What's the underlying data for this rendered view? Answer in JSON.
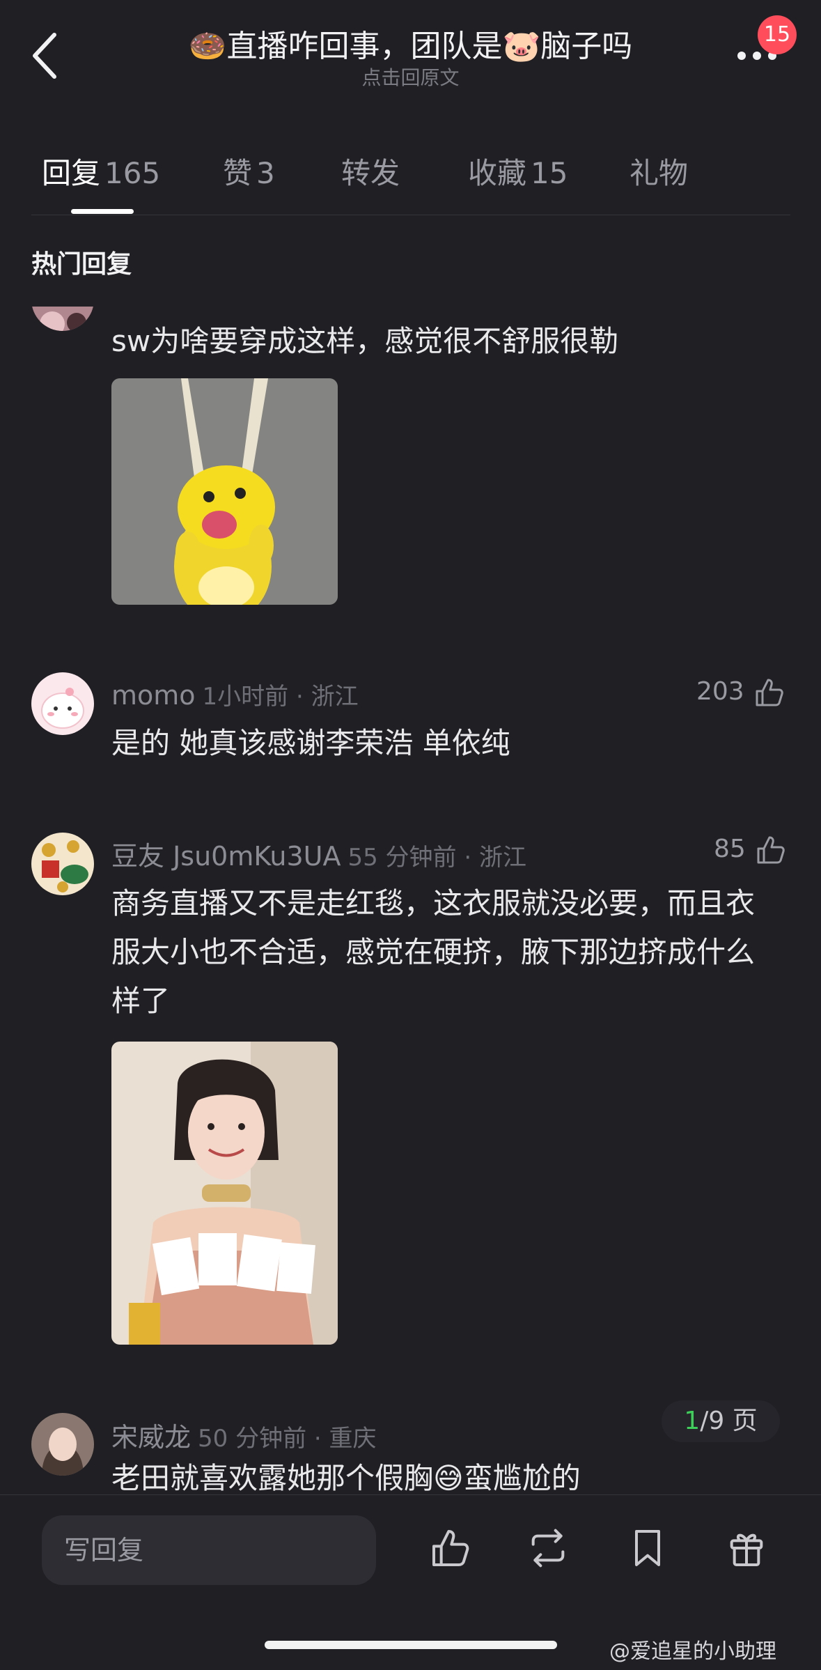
{
  "header": {
    "title": "🍩直播咋回事，团队是🐷脑子吗",
    "subtitle": "点击回原文",
    "badge_count": "15"
  },
  "tabs": [
    {
      "label": "回复",
      "count": "165",
      "active": true
    },
    {
      "label": "赞",
      "count": "3",
      "active": false
    },
    {
      "label": "转发",
      "count": "",
      "active": false
    },
    {
      "label": "收藏",
      "count": "15",
      "active": false
    },
    {
      "label": "礼物",
      "count": "",
      "active": false
    }
  ],
  "section_title": "热门回复",
  "comments": [
    {
      "text": "sw为啥要穿成这样，感觉很不舒服很勒",
      "image": "yellow-cartoon-sticker"
    },
    {
      "name": "momo",
      "meta": "1小时前 · 浙江",
      "likes": "203",
      "text": "是的 她真该感谢李荣浩 单依纯"
    },
    {
      "name": "豆友 Jsu0mKu3UA",
      "meta": "55 分钟前 · 浙江",
      "likes": "85",
      "text": "商务直播又不是走红毯，这衣服就没必要，而且衣服大小也不合适，感觉在硬挤，腋下那边挤成什么样了",
      "image": "woman-photo"
    },
    {
      "name": "宋威龙",
      "meta": "50 分钟前 · 重庆",
      "text": "老田就喜欢露她那个假胸😅蛮尴尬的"
    }
  ],
  "pager": {
    "current": "1",
    "total": "/9 页"
  },
  "bottom_bar": {
    "reply_placeholder": "写回复",
    "icons": [
      "like-icon",
      "repost-icon",
      "bookmark-icon",
      "gift-icon"
    ]
  },
  "watermark": "@爱追星的小助理",
  "colors": {
    "background": "#1f1f24",
    "badge": "#ff4d5b",
    "pager_current": "#3ecf5a"
  }
}
